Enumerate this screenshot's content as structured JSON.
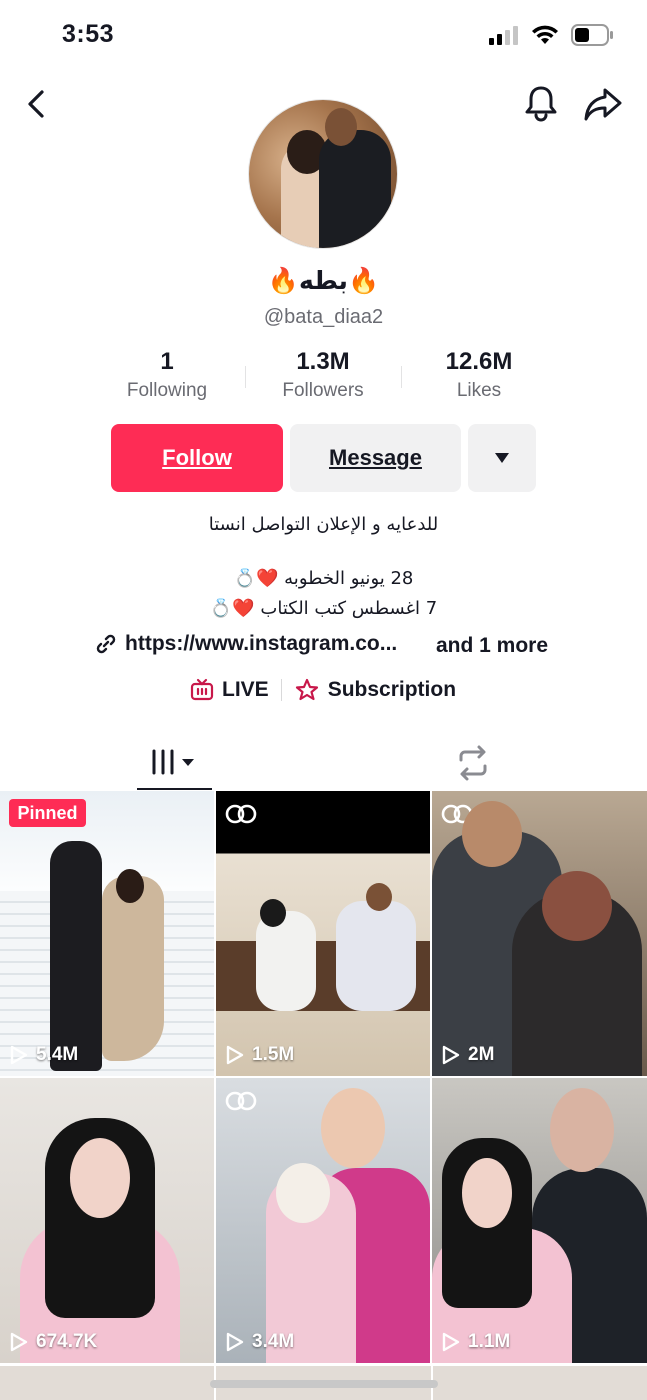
{
  "status": {
    "time": "3:53"
  },
  "profile": {
    "display_name": "🔥بطه🔥",
    "username": "@bata_diaa2",
    "stats": [
      {
        "value": "1",
        "label": "Following"
      },
      {
        "value": "1.3M",
        "label": "Followers"
      },
      {
        "value": "12.6M",
        "label": "Likes"
      }
    ]
  },
  "actions": {
    "follow": "Follow",
    "message": "Message"
  },
  "bio": {
    "line1": "للدعايه و الإعلان التواصل انستا",
    "line2": "28 يونيو الخطوبه ❤️💍",
    "line3": "7 اغسطس كتب الكتاب ❤️💍"
  },
  "link": {
    "url": "https://www.instagram.co...",
    "more": "and 1 more"
  },
  "badges": {
    "live": "LIVE",
    "subscription": "Subscription"
  },
  "videos": [
    {
      "views": "5.4M",
      "pinned_label": "Pinned"
    },
    {
      "views": "1.5M"
    },
    {
      "views": "2M"
    },
    {
      "views": "674.7K"
    },
    {
      "views": "3.4M"
    },
    {
      "views": "1.1M"
    }
  ],
  "colors": {
    "accent": "#fe2c55",
    "text": "#161823",
    "secondary": "#6a6b72"
  }
}
